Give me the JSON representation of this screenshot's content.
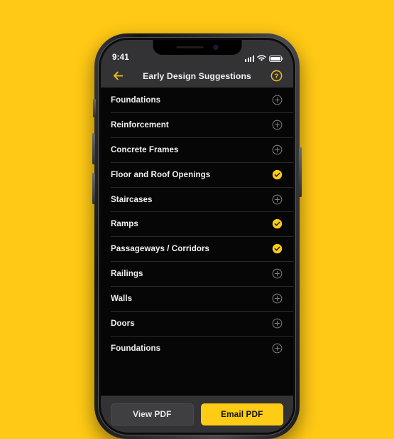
{
  "background_color": "#FFC915",
  "accent_color": "#FFCC15",
  "statusbar": {
    "time": "9:41",
    "signal_icon": "cellular-signal-icon",
    "wifi_icon": "wifi-icon",
    "battery_icon": "battery-icon"
  },
  "navbar": {
    "back_icon": "back-arrow-icon",
    "title": "Early Design Suggestions",
    "help_icon": "help-circle-icon"
  },
  "list": {
    "items": [
      {
        "label": "Foundations",
        "state": "add",
        "icon": "plus-circle-icon"
      },
      {
        "label": "Reinforcement",
        "state": "add",
        "icon": "plus-circle-icon"
      },
      {
        "label": "Concrete Frames",
        "state": "add",
        "icon": "plus-circle-icon"
      },
      {
        "label": "Floor and Roof Openings",
        "state": "selected",
        "icon": "check-circle-icon"
      },
      {
        "label": "Staircases",
        "state": "add",
        "icon": "plus-circle-icon"
      },
      {
        "label": "Ramps",
        "state": "selected",
        "icon": "check-circle-icon"
      },
      {
        "label": "Passageways / Corridors",
        "state": "selected",
        "icon": "check-circle-icon"
      },
      {
        "label": "Railings",
        "state": "add",
        "icon": "plus-circle-icon"
      },
      {
        "label": "Walls",
        "state": "add",
        "icon": "plus-circle-icon"
      },
      {
        "label": "Doors",
        "state": "add",
        "icon": "plus-circle-icon"
      },
      {
        "label": "Foundations",
        "state": "add",
        "icon": "plus-circle-icon"
      }
    ]
  },
  "actionbar": {
    "view_label": "View PDF",
    "email_label": "Email PDF"
  }
}
